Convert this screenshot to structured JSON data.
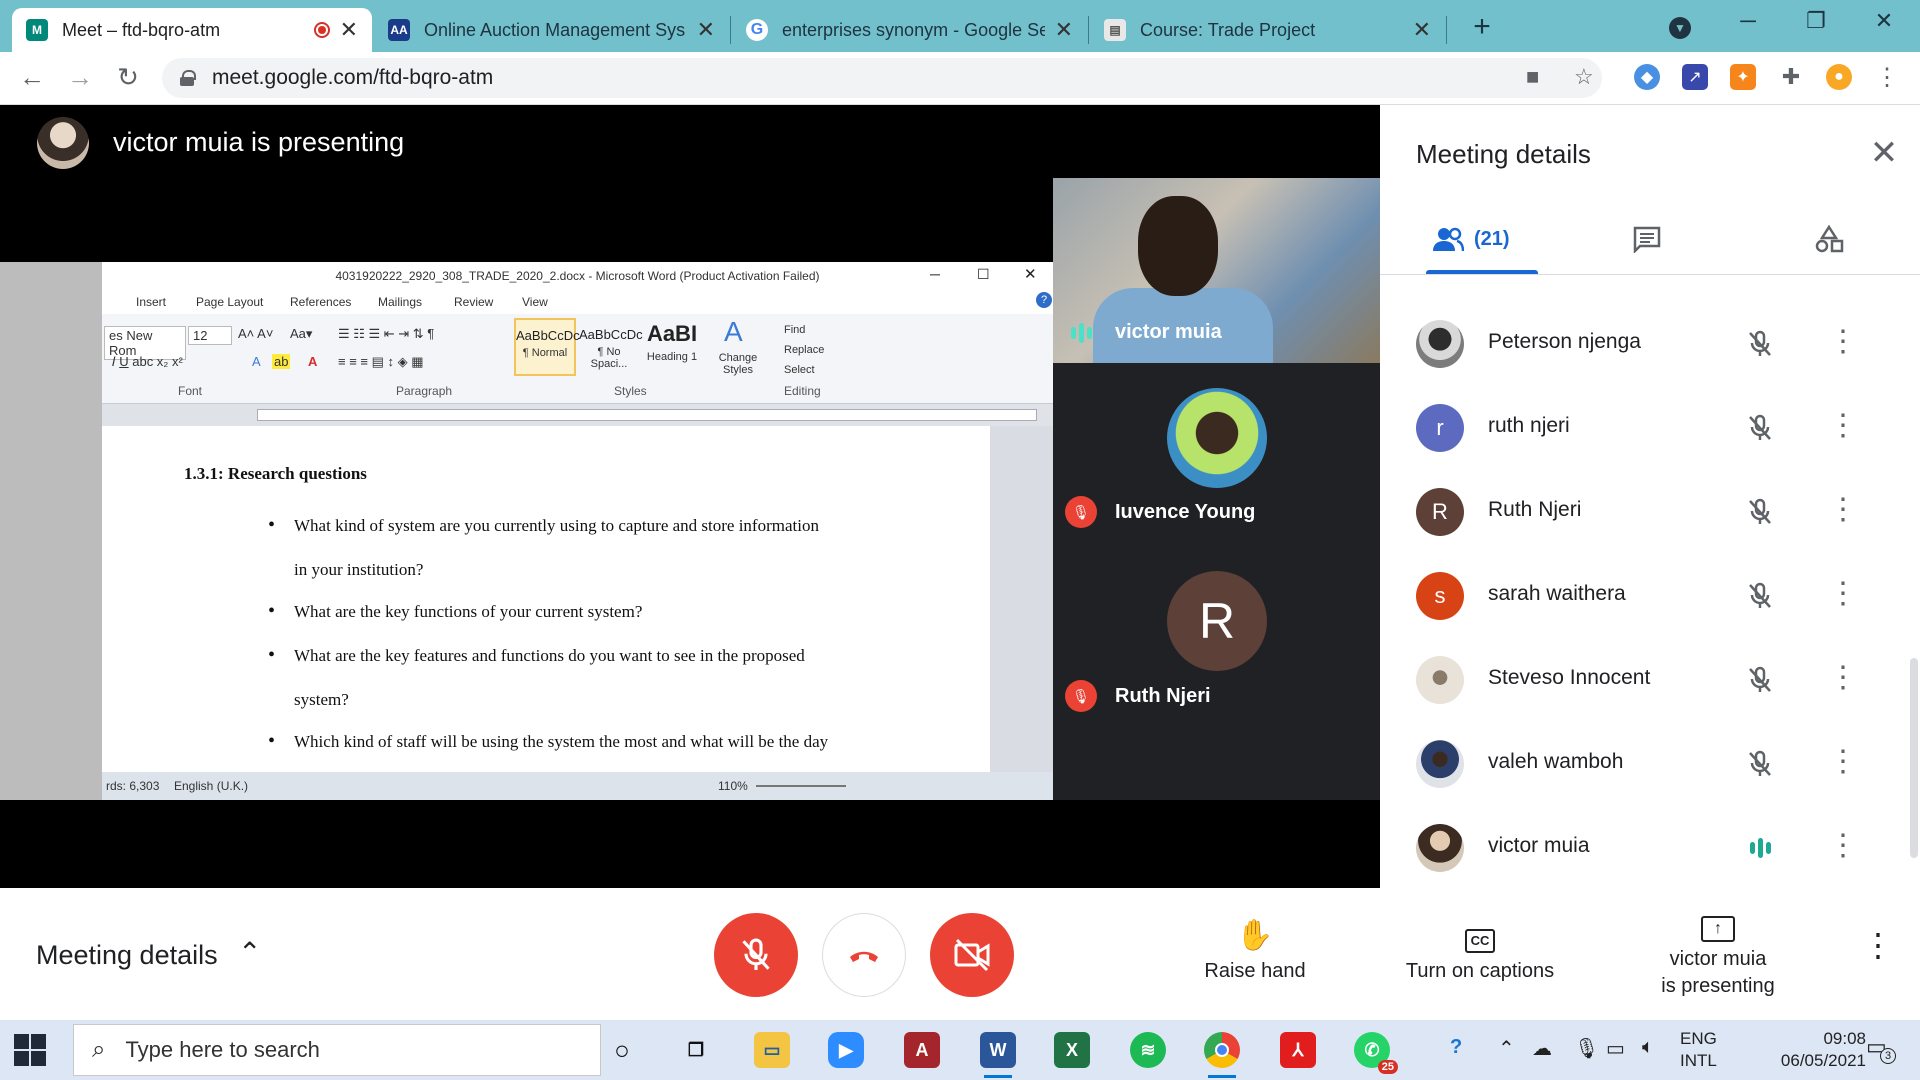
{
  "browser": {
    "tabs": [
      {
        "title": "Meet – ftd-bqro-atm",
        "active": true,
        "recording": true
      },
      {
        "title": "Online Auction Management Sys"
      },
      {
        "title": "enterprises synonym - Google Se"
      },
      {
        "title": "Course: Trade Project"
      }
    ],
    "new_tab": "+",
    "url": "meet.google.com/ftd-bqro-atm"
  },
  "presenting": {
    "text": "victor muia is presenting"
  },
  "word": {
    "title": "4031920222_2920_308_TRADE_2020_2.docx - Microsoft Word (Product Activation Failed)",
    "tabs": [
      "Insert",
      "Page Layout",
      "References",
      "Mailings",
      "Review",
      "View"
    ],
    "font_name": "es New Rom",
    "font_size": "12",
    "styles": [
      {
        "preview": "AaBbCcDc",
        "name": "¶ Normal"
      },
      {
        "preview": "AaBbCcDc",
        "name": "¶ No Spaci..."
      },
      {
        "preview": "AaBI",
        "name": "Heading 1"
      }
    ],
    "change_styles": "Change Styles",
    "find": "Find",
    "replace": "Replace",
    "select": "Select",
    "groups": [
      "Font",
      "Paragraph",
      "Styles",
      "Editing"
    ],
    "heading": "1.3.1: Research questions",
    "bullets": [
      "What kind of system are you currently using to capture and store information",
      "What are the key functions of your current system?",
      "What are the key features and functions do you want to see in the proposed",
      "Which kind of staff will be using the system the most and what will be the day"
    ],
    "continuations": [
      "in your institution?",
      "system?"
    ],
    "status_words": "rds: 6,303",
    "status_lang": "English (U.K.)",
    "zoom": "110%"
  },
  "tiles": [
    {
      "name": "victor muia",
      "speaking": true
    },
    {
      "name": "Iuvence Young",
      "muted": true
    },
    {
      "name": "Ruth Njeri",
      "muted": true,
      "initial": "R"
    }
  ],
  "panel": {
    "title": "Meeting details",
    "people_count": "(21)",
    "participants": [
      {
        "name": "Peterson njenga",
        "initial": "",
        "color": "#8a8a8a",
        "muted": true
      },
      {
        "name": "ruth njeri",
        "initial": "r",
        "color": "#5c6bc0",
        "muted": true
      },
      {
        "name": "Ruth Njeri",
        "initial": "R",
        "color": "#5d4037",
        "muted": true
      },
      {
        "name": "sarah waithera",
        "initial": "s",
        "color": "#d84315",
        "muted": true
      },
      {
        "name": "Steveso Innocent",
        "initial": "",
        "color": "#bdb3a6",
        "muted": true
      },
      {
        "name": "valeh wamboh",
        "initial": "",
        "color": "#7a8a99",
        "muted": true
      },
      {
        "name": "victor muia",
        "initial": "",
        "color": "#6d5a4a",
        "muted": false
      }
    ]
  },
  "controls": {
    "meeting_details": "Meeting details",
    "raise_hand": "Raise hand",
    "captions": "Turn on captions",
    "present_line1": "victor muia",
    "present_line2": "is presenting"
  },
  "taskbar": {
    "search_placeholder": "Type here to search",
    "lang_line1": "ENG",
    "lang_line2": "INTL",
    "time": "09:08",
    "date": "06/05/2021",
    "notifications": "3",
    "whatsapp_badge": "25"
  },
  "colors": {
    "red": "#ea4335",
    "blue": "#1967d2",
    "teal": "#72c0cc"
  }
}
